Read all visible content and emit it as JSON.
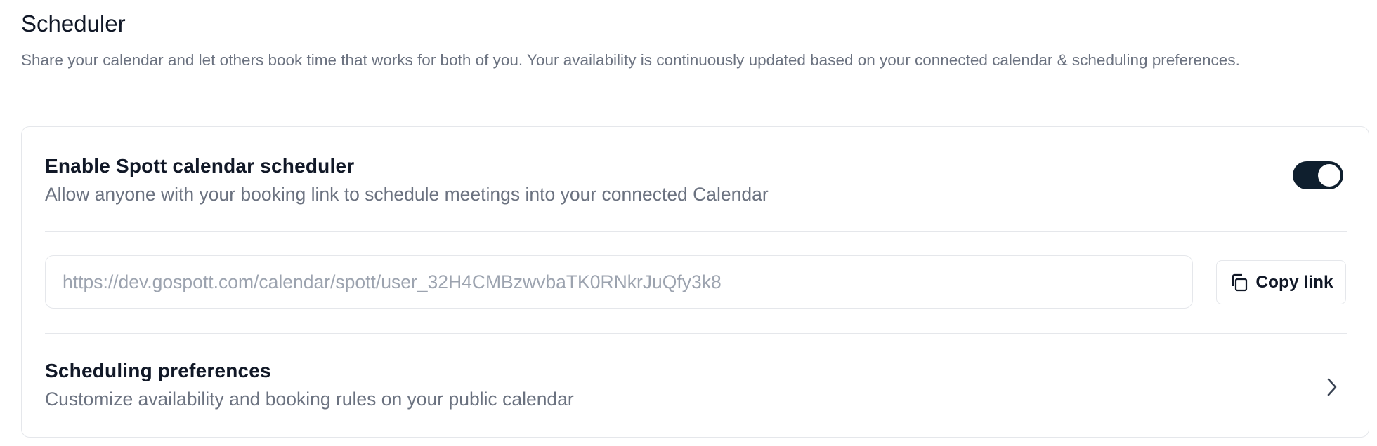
{
  "header": {
    "title": "Scheduler",
    "description": "Share your calendar and let others book time that works for both of you. Your availability is continuously updated based on your connected calendar & scheduling preferences."
  },
  "scheduler_toggle": {
    "title": "Enable Spott calendar scheduler",
    "description": "Allow anyone with your booking link to schedule meetings into your connected Calendar",
    "enabled": true
  },
  "booking_link": {
    "value": "https://dev.gospott.com/calendar/spott/user_32H4CMBzwvbaTK0RNkrJuQfy3k8",
    "copy_label": "Copy link",
    "copy_icon": "copy-icon"
  },
  "preferences": {
    "title": "Scheduling preferences",
    "description": "Customize availability and booking rules on your public calendar",
    "icon": "chevron-right-icon"
  },
  "colors": {
    "toggle_on": "#0f1f2e",
    "text_primary": "#111827",
    "text_muted": "#6b7280",
    "border": "#e5e7eb"
  }
}
